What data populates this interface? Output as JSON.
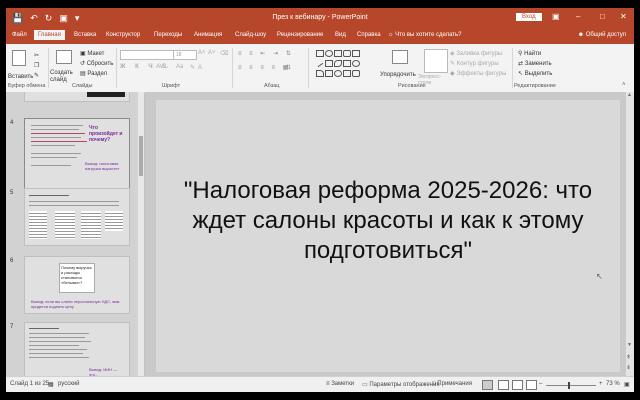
{
  "window": {
    "title": "През к вебинару  -  PowerPoint",
    "signin": "Вход"
  },
  "tabs": [
    "Файл",
    "Главная",
    "Вставка",
    "Конструктор",
    "Переходы",
    "Анимация",
    "Слайд-шоу",
    "Рецензирование",
    "Вид",
    "Справка"
  ],
  "tell_me": "Что вы хотите сделать?",
  "share": "Общий доступ",
  "ribbon": {
    "paste": "Вставить",
    "clipboard": "Буфер обмена",
    "new_slide": "Создать слайд",
    "layout": "Макет",
    "reset": "Сбросить",
    "section": "Раздел",
    "slides": "Слайды",
    "font_size": "18",
    "font": "Шрифт",
    "paragraph": "Абзац",
    "arrange": "Упорядочить",
    "quick_styles": "Экспресс-стили",
    "shape_fill": "Заливка фигуры",
    "shape_outline": "Контур фигуры",
    "shape_effects": "Эффекты фигуры",
    "drawing": "Рисование",
    "find": "Найти",
    "replace": "Заменить",
    "select": "Выделить",
    "editing": "Редактирование"
  },
  "thumbnails": [
    {
      "num": "4",
      "heading": "Что произойдет и почему?",
      "note": "Вывод: налоговая нагрузка вырастет"
    },
    {
      "num": "5",
      "heading": "",
      "note": ""
    },
    {
      "num": "6",
      "heading": "Почему выручка и расходы становятся «белыми»?",
      "note": "Вывод: если вы слили персональную НДС, вам придется поднять цену"
    },
    {
      "num": "7",
      "heading": "",
      "note": "Вывод: ИИН — это..."
    }
  ],
  "slide": {
    "title": "\"Налоговая реформа 2025-2026: что ждет салоны красоты и как к этому подготовиться\""
  },
  "status": {
    "slide_counter": "Слайд 1 из 25",
    "language": "русский",
    "notes": "Заметки",
    "display_settings": "Параметры отображения",
    "comments": "Примечания",
    "zoom": "73 %"
  }
}
